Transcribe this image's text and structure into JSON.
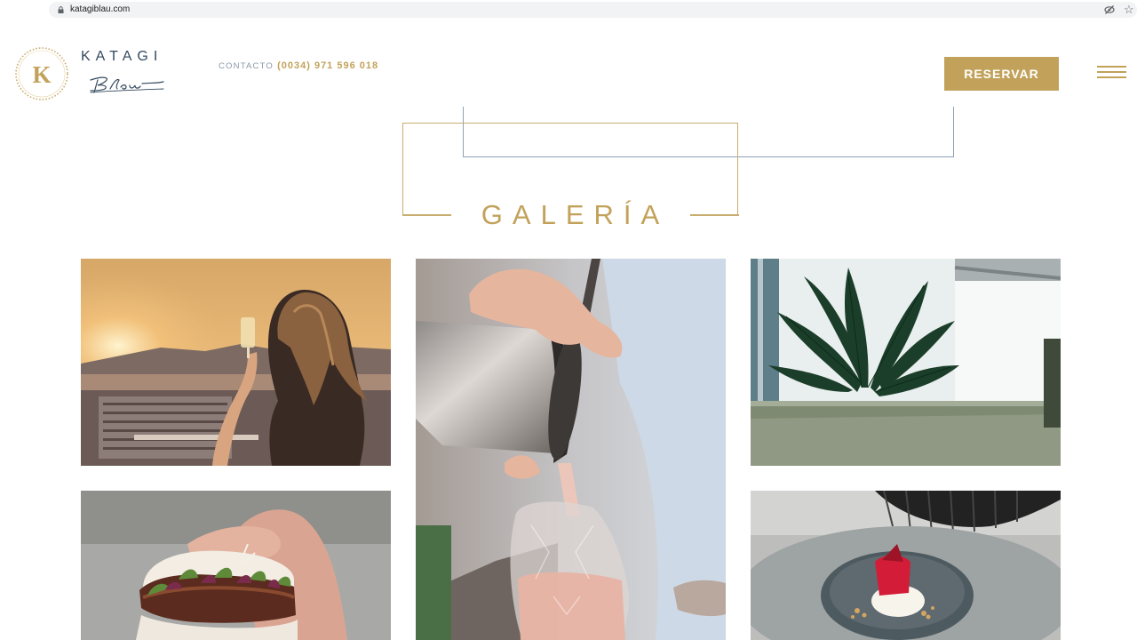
{
  "browser": {
    "url": "katagiblau.com",
    "lock_icon": "lock-icon",
    "eye_icon": "eye-off-icon",
    "star_icon": "star-icon"
  },
  "header": {
    "brand_name": "KATAGI",
    "logo_letter": "K",
    "brand_script": "Blau",
    "contact_label": "CONTACTO",
    "contact_phone": "(0034) 971 596 018",
    "reserve_label": "RESERVAR",
    "menu_icon": "hamburger-menu-icon"
  },
  "gallery": {
    "title": "GALERÍA",
    "images": [
      {
        "name": "woman-sunset-wine",
        "alt": "Woman with wine at sunset"
      },
      {
        "name": "cocktail-pour",
        "alt": "Cocktail being poured"
      },
      {
        "name": "palm-leaves",
        "alt": "Palm leaves on terrace"
      },
      {
        "name": "bao-bun",
        "alt": "Bao bun in hand"
      },
      {
        "name": "dessert-plate",
        "alt": "Dessert on plate"
      }
    ]
  },
  "colors": {
    "accent_gold": "#c2a25a",
    "brand_navy": "#34495e",
    "frame_blue": "#8da3b8"
  }
}
